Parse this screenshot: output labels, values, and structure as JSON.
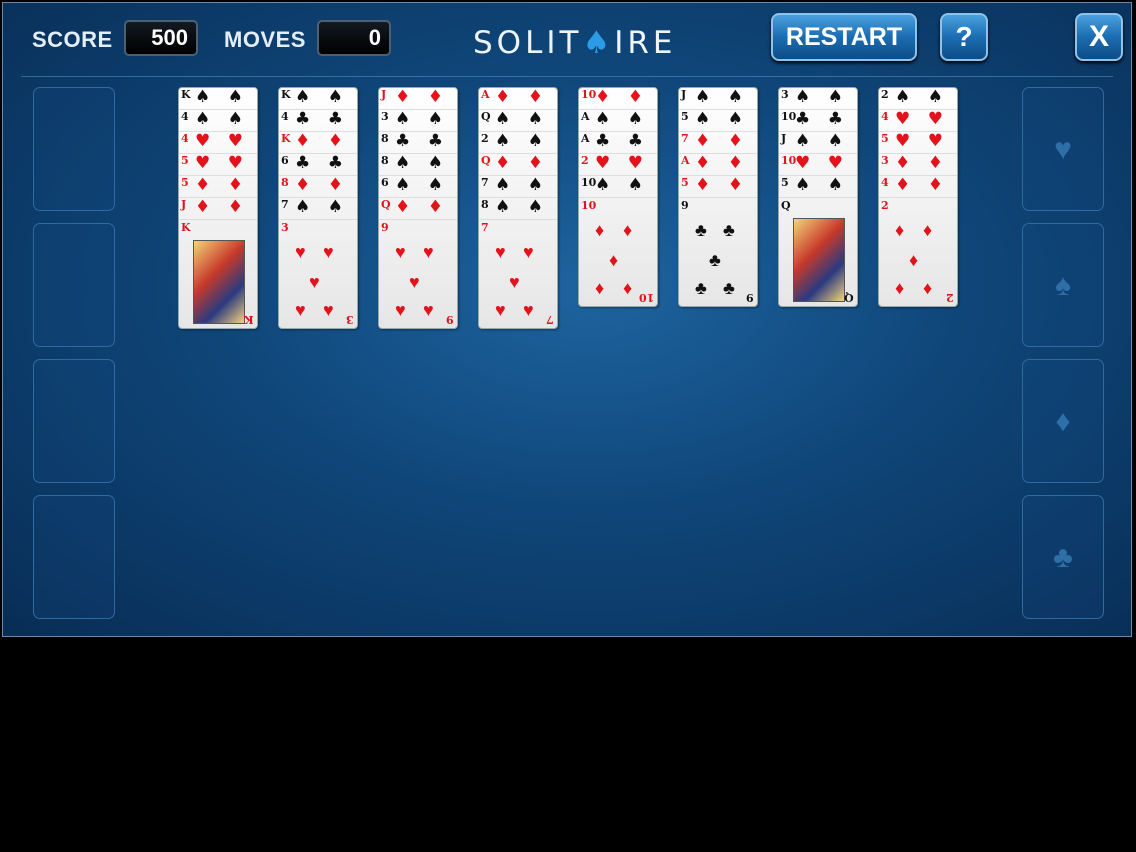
{
  "header": {
    "score_label": "SCORE",
    "score_value": "500",
    "moves_label": "MOVES",
    "moves_value": "0",
    "logo_left": "SOLIT",
    "logo_spade": "♠",
    "logo_right": "IRE",
    "restart_label": "RESTART",
    "help_label": "?",
    "close_label": "X"
  },
  "colors": {
    "red": "#e2131b",
    "black": "#111111",
    "felt": "#0f4679",
    "button": "#1b6db2"
  },
  "foundations": [
    "♥",
    "♠",
    "♦",
    "♣"
  ],
  "columns": [
    {
      "cards": [
        [
          "K",
          "♠"
        ],
        [
          "4",
          "♠"
        ],
        [
          "4",
          "♥"
        ],
        [
          "5",
          "♥"
        ],
        [
          "5",
          "♦"
        ],
        [
          "J",
          "♦"
        ],
        [
          "K",
          "♥"
        ]
      ],
      "bottom_face": true
    },
    {
      "cards": [
        [
          "K",
          "♠"
        ],
        [
          "4",
          "♣"
        ],
        [
          "K",
          "♦"
        ],
        [
          "6",
          "♣"
        ],
        [
          "8",
          "♦"
        ],
        [
          "7",
          "♠"
        ],
        [
          "3",
          "♥"
        ]
      ],
      "bottom_face": false
    },
    {
      "cards": [
        [
          "J",
          "♦"
        ],
        [
          "3",
          "♠"
        ],
        [
          "8",
          "♣"
        ],
        [
          "8",
          "♠"
        ],
        [
          "6",
          "♠"
        ],
        [
          "Q",
          "♦"
        ],
        [
          "9",
          "♥"
        ]
      ],
      "bottom_face": false
    },
    {
      "cards": [
        [
          "A",
          "♦"
        ],
        [
          "Q",
          "♠"
        ],
        [
          "2",
          "♠"
        ],
        [
          "Q",
          "♦"
        ],
        [
          "7",
          "♠"
        ],
        [
          "8",
          "♠"
        ],
        [
          "7",
          "♥"
        ]
      ],
      "bottom_face": false
    },
    {
      "cards": [
        [
          "10",
          "♦"
        ],
        [
          "A",
          "♠"
        ],
        [
          "A",
          "♣"
        ],
        [
          "2",
          "♥"
        ],
        [
          "10",
          "♠"
        ],
        [
          "10",
          "♦"
        ]
      ],
      "bottom_face": false
    },
    {
      "cards": [
        [
          "J",
          "♠"
        ],
        [
          "5",
          "♠"
        ],
        [
          "7",
          "♦"
        ],
        [
          "A",
          "♦"
        ],
        [
          "5",
          "♦"
        ],
        [
          "9",
          "♣"
        ]
      ],
      "bottom_face": false
    },
    {
      "cards": [
        [
          "3",
          "♠"
        ],
        [
          "10",
          "♣"
        ],
        [
          "J",
          "♠"
        ],
        [
          "10",
          "♥"
        ],
        [
          "5",
          "♠"
        ],
        [
          "Q",
          "♣"
        ]
      ],
      "bottom_face": true
    },
    {
      "cards": [
        [
          "2",
          "♠"
        ],
        [
          "4",
          "♥"
        ],
        [
          "5",
          "♥"
        ],
        [
          "3",
          "♦"
        ],
        [
          "4",
          "♦"
        ],
        [
          "2",
          "♦"
        ]
      ],
      "bottom_face": false
    }
  ]
}
